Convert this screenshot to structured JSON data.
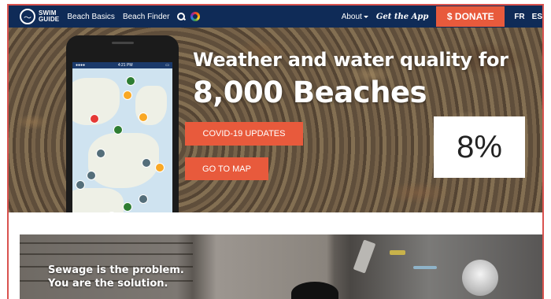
{
  "nav": {
    "logo_line1": "SWIM",
    "logo_line2": "GUIDE",
    "links": [
      "Beach Basics",
      "Beach Finder"
    ],
    "about": "About",
    "get_app": "Get the App",
    "donate": "$ DONATE",
    "lang_fr": "FR",
    "lang_es": "ES"
  },
  "hero": {
    "title": "Weather and water quality for",
    "count": "8,000 Beaches",
    "btn_covid": "COVID-19 UPDATES",
    "btn_map": "GO TO MAP"
  },
  "phone": {
    "status_left": "●●●●",
    "status_time": "4:21 PM"
  },
  "overlay": {
    "percent": "8%"
  },
  "section2": {
    "line1": "Sewage is the problem.",
    "line2": "You are the solution."
  },
  "colors": {
    "nav_bg": "#0f2b57",
    "accent": "#e85a3c",
    "frame": "#d9534f"
  }
}
